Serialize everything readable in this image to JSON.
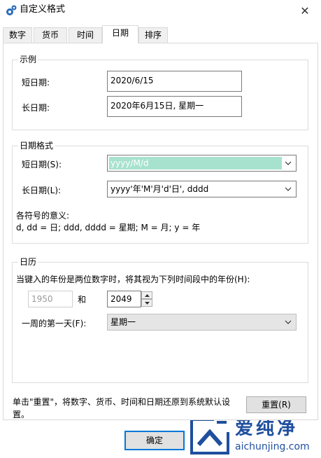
{
  "window": {
    "title": "自定义格式",
    "close_glyph": "✕"
  },
  "tabs": [
    {
      "label": "数字"
    },
    {
      "label": "货币"
    },
    {
      "label": "时间"
    },
    {
      "label": "日期",
      "active": true
    },
    {
      "label": "排序"
    }
  ],
  "example": {
    "title": "示例",
    "short_label": "短日期:",
    "short_value": "2020/6/15",
    "long_label": "长日期:",
    "long_value": "2020年6月15日, 星期一"
  },
  "date_format": {
    "title": "日期格式",
    "short_label": "短日期(S):",
    "short_value": "yyyy/M/d",
    "long_label": "长日期(L):",
    "long_value": "yyyy'年'M'月'd'日', dddd",
    "legend_title": "各符号的意义:",
    "legend_text": "d, dd = 日;  ddd, dddd = 星期;  M = 月;  y = 年"
  },
  "calendar": {
    "title": "日历",
    "desc": "当键入的年份是两位数字时，将其视为下列时间段中的年份(H):",
    "start_year": "1950",
    "and_label": "和",
    "end_year": "2049",
    "first_day_label": "一周的第一天(F):",
    "first_day_value": "星期一"
  },
  "footer": {
    "reset_desc_line1": "单击\"重置\"，将数字、货币、时间和日期还原到系统默认设",
    "reset_desc_line2": "置。",
    "reset_button": "重置(R)",
    "ok_button": "确定",
    "watermark_text": "爱纯净",
    "watermark_url": "aichunjing.com"
  },
  "colors": {
    "selection": "#a7e2cf",
    "primary_border": "#0078d7",
    "watermark_blue": "#1f4f9e"
  }
}
